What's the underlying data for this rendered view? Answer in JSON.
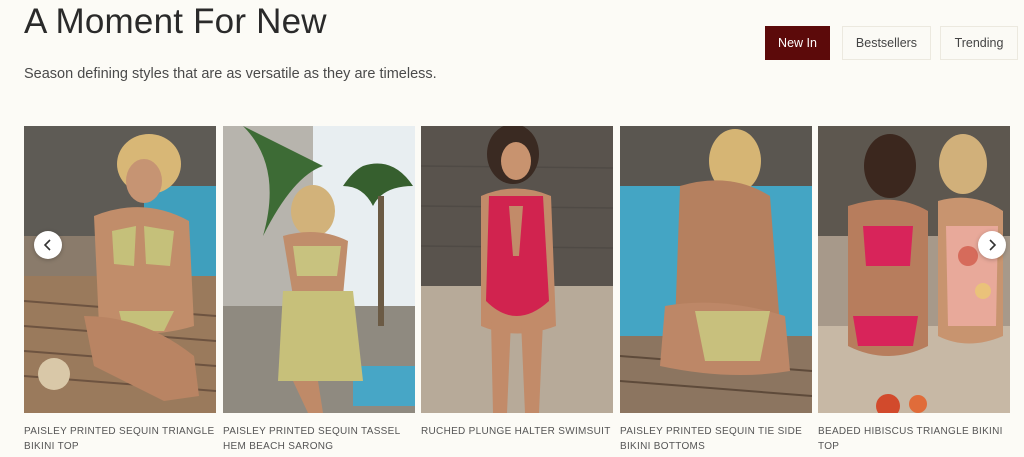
{
  "header": {
    "title": "A Moment For New",
    "subtitle": "Season defining styles that are as versatile as they are timeless."
  },
  "tabs": [
    {
      "label": "New In",
      "active": true
    },
    {
      "label": "Bestsellers",
      "active": false
    },
    {
      "label": "Trending",
      "active": false
    }
  ],
  "products": [
    {
      "name": "PAISLEY PRINTED SEQUIN TRIANGLE BIKINI TOP"
    },
    {
      "name": "PAISLEY PRINTED SEQUIN TASSEL HEM BEACH SARONG"
    },
    {
      "name": "RUCHED PLUNGE HALTER SWIMSUIT"
    },
    {
      "name": "PAISLEY PRINTED SEQUIN TIE SIDE BIKINI BOTTOMS"
    },
    {
      "name": "BEADED HIBISCUS TRIANGLE BIKINI TOP"
    }
  ],
  "carousel": {
    "prev_icon": "chevron-left-icon",
    "next_icon": "chevron-right-icon"
  },
  "colors": {
    "background": "#fcfbf6",
    "active_tab": "#5c0a0a"
  }
}
